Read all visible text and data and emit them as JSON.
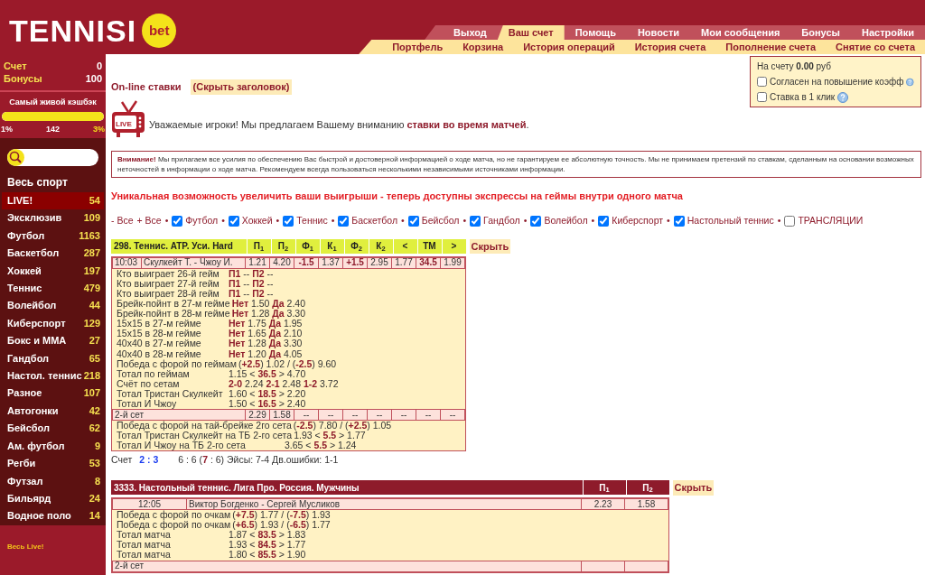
{
  "header": {
    "logo": "TENNISI",
    "logo_badge": "bet",
    "top_menu": [
      {
        "label": "Выход",
        "selected": false
      },
      {
        "label": "Ваш счет",
        "selected": true
      },
      {
        "label": "Помощь",
        "selected": false
      },
      {
        "label": "Новости",
        "selected": false
      },
      {
        "label": "Мои сообщения",
        "selected": false
      },
      {
        "label": "Бонусы",
        "selected": false
      },
      {
        "label": "Настройки",
        "selected": false
      }
    ],
    "sub_menu": [
      "Портфель",
      "Корзина",
      "История операций",
      "История счета",
      "Пополнение счета",
      "Снятие со счета"
    ]
  },
  "sidebar": {
    "account": [
      {
        "label": "Счет",
        "value": "0"
      },
      {
        "label": "Бонусы",
        "value": "100"
      }
    ],
    "cashback": {
      "title": "Самый живой кэшбэк",
      "level": 1,
      "min": "1%",
      "count": "142",
      "max": "3%"
    },
    "all_sports": "Весь спорт",
    "sports": [
      {
        "name": "LIVE!",
        "count": "54",
        "selected": true
      },
      {
        "name": "Эксклюзив",
        "count": "109",
        "selected": false
      },
      {
        "name": "Футбол",
        "count": "1163",
        "selected": false
      },
      {
        "name": "Баскетбол",
        "count": "287",
        "selected": false
      },
      {
        "name": "Хоккей",
        "count": "197",
        "selected": false
      },
      {
        "name": "Теннис",
        "count": "479",
        "selected": false
      },
      {
        "name": "Волейбол",
        "count": "44",
        "selected": false
      },
      {
        "name": "Киберспорт",
        "count": "129",
        "selected": false
      },
      {
        "name": "Бокс и ММА",
        "count": "27",
        "selected": false
      },
      {
        "name": "Гандбол",
        "count": "65",
        "selected": false
      },
      {
        "name": "Настол. теннис",
        "count": "218",
        "selected": false
      },
      {
        "name": "Разное",
        "count": "107",
        "selected": false
      },
      {
        "name": "Автогонки",
        "count": "42",
        "selected": false
      },
      {
        "name": "Бейсбол",
        "count": "62",
        "selected": false
      },
      {
        "name": "Ам. футбол",
        "count": "9",
        "selected": false
      },
      {
        "name": "Регби",
        "count": "53",
        "selected": false
      },
      {
        "name": "Футзал",
        "count": "8",
        "selected": false
      },
      {
        "name": "Бильярд",
        "count": "24",
        "selected": false
      },
      {
        "name": "Водное поло",
        "count": "14",
        "selected": false
      }
    ],
    "footer_link": "Весь Live!"
  },
  "content": {
    "title": "On-line ставки",
    "hide_header": "(Скрыть заголовок)",
    "balance": {
      "text": "На счету **0.00** руб",
      "options": [
        {
          "label": "Согласен на повышение коэфф",
          "checked": false
        },
        {
          "label": "Ставка в 1 клик",
          "checked": false
        }
      ]
    },
    "live_badge": "LIVE",
    "promo": "Уважаемые игроки! Мы предлагаем Вашему вниманию **ставки во время матчей**.",
    "warning": "**Внимание!** Мы прилагаем все усилия по обеспечению Вас быстрой и достоверной информацией о ходе матча, но не гарантируем ее абсолютную точность. Мы не принимаем претензий по ставкам, сделанным на основании возможных неточностей в информации о ходе матча. Рекомендуем всегда пользоваться несколькими независимыми источниками информации.",
    "headline": "Уникальная возможность увеличить ваши выигрыши - теперь доступны экспрессы на геймы внутри одного матча",
    "filters": [
      {
        "kind": "link",
        "label": "- Все"
      },
      {
        "kind": "link",
        "label": "+ Все",
        "sep": "•"
      },
      {
        "kind": "checkbox",
        "label": "Футбол",
        "checked": true,
        "sep": "•"
      },
      {
        "kind": "checkbox",
        "label": "Хоккей",
        "checked": true,
        "sep": "•"
      },
      {
        "kind": "checkbox",
        "label": "Теннис",
        "checked": true,
        "sep": "•"
      },
      {
        "kind": "checkbox",
        "label": "Баскетбол",
        "checked": true,
        "sep": "•"
      },
      {
        "kind": "checkbox",
        "label": "Бейсбол",
        "checked": true,
        "sep": "•"
      },
      {
        "kind": "checkbox",
        "label": "Гандбол",
        "checked": true,
        "sep": "•"
      },
      {
        "kind": "checkbox",
        "label": "Волейбол",
        "checked": true,
        "sep": "•"
      },
      {
        "kind": "checkbox",
        "label": "Киберспорт",
        "checked": true,
        "sep": "•"
      },
      {
        "kind": "checkbox",
        "label": "Настольный теннис",
        "checked": true,
        "sep": "•"
      },
      {
        "kind": "checkbox",
        "label": "ТРАНСЛЯЦИИ",
        "checked": false
      }
    ],
    "events": [
      {
        "title": "298. Теннис. ATP. Уси. Hard",
        "color": "#e0ef3e",
        "hide": "Скрыть",
        "columns": [
          "П$_{1}$",
          "П$_{2}$",
          "Ф$_{1}$",
          "К$_{1}$",
          "Ф$_{2}$",
          "К$_{2}$",
          "<",
          "ТМ",
          ">"
        ],
        "match": {
          "time": "10:03",
          "teams": "Скулкейт Т. - Чжоу И.",
          "odds": [
            "1.21",
            "4.20",
            "**-1.5**",
            "1.37",
            "**+1.5**",
            "2.95",
            "1.77",
            "**34.5**",
            "1.99"
          ]
        },
        "markets": [
          {
            "label": "Кто выиграет 26-й гейм",
            "value": "**П1** --  **П2** --"
          },
          {
            "label": "Кто выиграет 27-й гейм",
            "value": "**П1** --  **П2** --"
          },
          {
            "label": "Кто выиграет 28-й гейм",
            "value": "**П1** --  **П2** --"
          },
          {
            "label": "Брейк-пойнт в 27-м гейме",
            "value": "**Нет** 1.50  **Да** 2.40"
          },
          {
            "label": "Брейк-пойнт в 28-м гейме",
            "value": "**Нет** 1.28  **Да** 3.30"
          },
          {
            "label": "15x15 в 27-м гейме",
            "value": "**Нет** 1.75  **Да** 1.95"
          },
          {
            "label": "15x15 в 28-м гейме",
            "value": "**Нет** 1.65  **Да** 2.10"
          },
          {
            "label": "40x40 в 27-м гейме",
            "value": "**Нет** 1.28  **Да** 3.30"
          },
          {
            "label": "40x40 в 28-м гейме",
            "value": "**Нет** 1.20  **Да** 4.05"
          },
          {
            "label": "Победа с форой по геймам",
            "value": "(**+2.5**) 1.02 / (**-2.5**) 9.60"
          },
          {
            "label": "Тотал по геймам",
            "value": "1.15 < **36.5** > 4.70"
          },
          {
            "label": "Счёт по сетам",
            "value": "**2-0** 2.24 **2-1** 2.48 **1-2** 3.72"
          },
          {
            "label": "Тотал Тристан Скулкейт",
            "value": "1.60 < **18.5** > 2.20"
          },
          {
            "label": "Тотал И Чжоу",
            "value": "1.50 < **16.5** > 2.40"
          }
        ],
        "set": {
          "label": "2-й сет",
          "odds": [
            "2.29",
            "1.58",
            "--",
            "--",
            "--",
            "--",
            "--",
            "--",
            "--"
          ],
          "markets": [
            {
              "label": "Победа с форой на тай-брейке 2го сета",
              "value": "(**-2.5**) 7.80 / (**+2.5**) 1.05"
            },
            {
              "label": "Тотал Тристан Скулкейт на ТБ 2-го сета",
              "value": "1.93 < **5.5** > 1.77"
            },
            {
              "label": "Тотал И Чжоу на ТБ 2-го сета",
              "value": "3.65 < **5.5** > 1.24"
            }
          ]
        },
        "score": {
          "label": "Счет",
          "sets": "2 : 3",
          "detail": "6 : 6  (**7** : 6) Эйсы: 7-4 Дв.ошибки: 1-1"
        }
      },
      {
        "title": "3333. Настольный теннис. Лига Про. Россия. Мужчины",
        "color": "#8e1b2b",
        "hide": "Скрыть",
        "columns": [
          "П$_{1}$",
          "П$_{2}$"
        ],
        "match": {
          "time": "12:05",
          "teams": "Виктор Богденко - Сергей Мусликов",
          "odds": [
            "2.23",
            "1.58"
          ]
        },
        "markets": [
          {
            "label": "Победа с форой по очкам",
            "value": "(**+7.5**) 1.77 / (**-7.5**) 1.93"
          },
          {
            "label": "Победа с форой по очкам",
            "value": "(**+6.5**) 1.93 / (**-6.5**) 1.77"
          },
          {
            "label": "Тотал матча",
            "value": "1.87 < **83.5** > 1.83"
          },
          {
            "label": "Тотал матча",
            "value": "1.93 < **84.5** > 1.77"
          },
          {
            "label": "Тотал матча",
            "value": "1.80 < **85.5** > 1.90"
          }
        ],
        "set": {
          "label": "2-й сет"
        }
      }
    ]
  }
}
